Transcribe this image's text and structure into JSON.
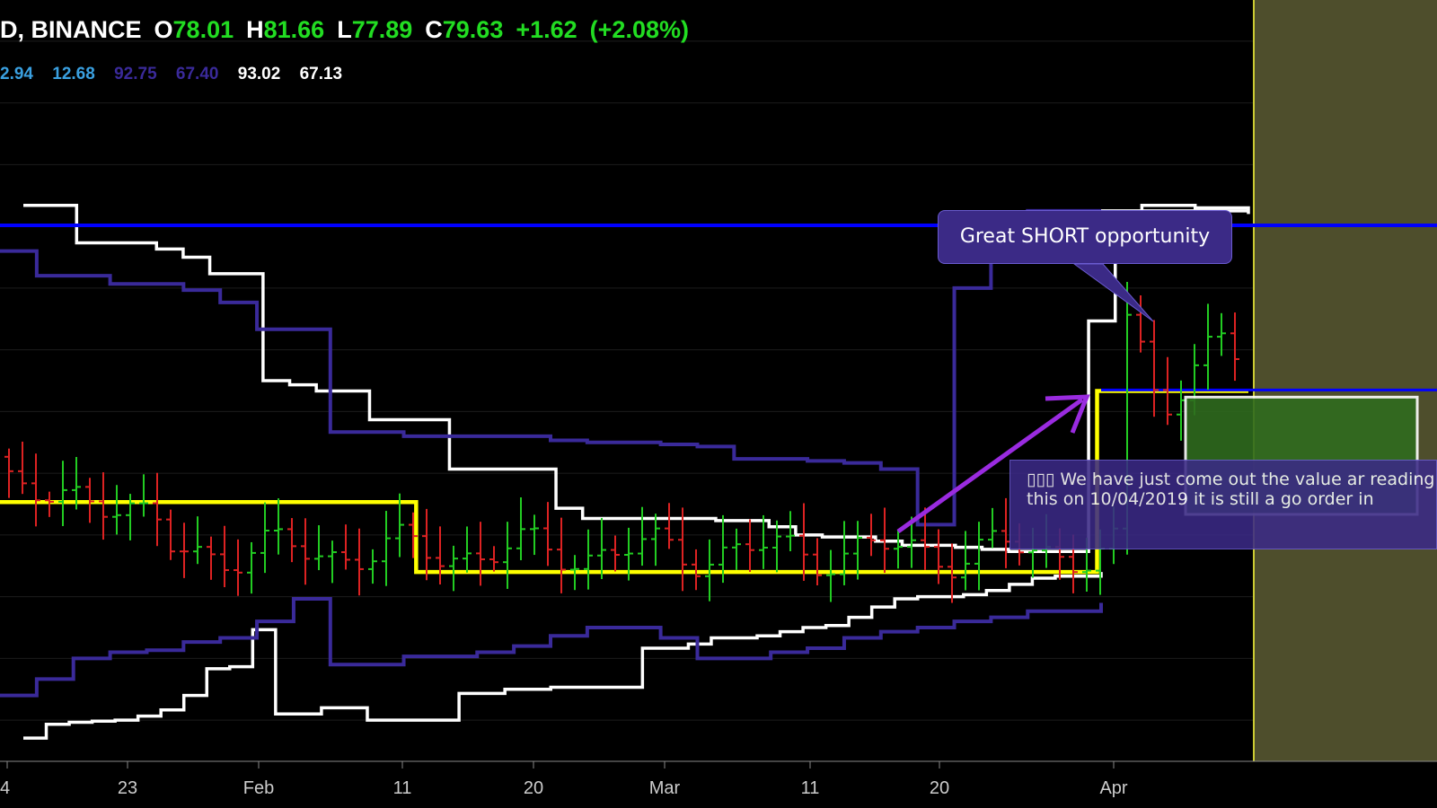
{
  "header": {
    "symbol": "D, BINANCE",
    "open_label": "O",
    "open": "78.01",
    "high_label": "H",
    "high": "81.66",
    "low_label": "L",
    "low": "77.89",
    "close_label": "C",
    "close": "79.63",
    "change": "+1.62",
    "change_pct": "(+2.08%)"
  },
  "indicators": [
    "2.94",
    "12.68",
    "92.75",
    "67.40",
    "93.02",
    "67.13"
  ],
  "colors": {
    "background": "#000000",
    "up": "#22cc22",
    "down": "#dd2222",
    "upper_outer": "#ffffff",
    "inner_band": "#3a2a9a",
    "yellow": "#ffff00",
    "blue": "#0000ff",
    "forecast_zone": "#4e4e2c",
    "arrow": "#9a2be0",
    "value_green": "#2f6b1e",
    "callout_bg": "#3b2a86"
  },
  "annotations": {
    "short_callout": "Great SHORT opportunity",
    "value_callout": "▯▯▯ We have just come out the value ar reading this on 10/04/2019 it is still a go order in"
  },
  "chart_data": {
    "type": "candlestick",
    "x_tick_labels": [
      "4",
      "23",
      "Feb",
      "11",
      "20",
      "Mar",
      "11",
      "20",
      "Apr"
    ],
    "series": [
      {
        "values": [
          93.02,
          93.02,
          91.2,
          91.2,
          91.2,
          90.9,
          90.5,
          89.7,
          89.7,
          84.5,
          84.3,
          84.0,
          84.0,
          82.6,
          82.6,
          82.6,
          80.2,
          80.2,
          80.2,
          80.2,
          78.3,
          77.8,
          77.8,
          77.8,
          77.8,
          77.8,
          77.7,
          77.7,
          77.4,
          77.0,
          76.9,
          76.9,
          76.7,
          76.5,
          76.5,
          76.4,
          76.3,
          76.2,
          76.2,
          76.2,
          87.4,
          92.6,
          93.02,
          93.02,
          92.9,
          92.9,
          92.6
        ]
      },
      {
        "values": [
          67.13,
          67.8,
          67.9,
          67.95,
          68.0,
          68.2,
          68.5,
          69.2,
          70.5,
          70.6,
          72.4,
          68.3,
          68.3,
          68.6,
          68.6,
          68.0,
          68.0,
          68.0,
          68.0,
          69.3,
          69.3,
          69.5,
          69.5,
          69.6,
          69.6,
          69.6,
          69.6,
          71.5,
          71.5,
          71.7,
          72.0,
          72.0,
          72.1,
          72.3,
          72.5,
          72.6,
          73.0,
          73.5,
          73.9,
          74.0,
          74.0,
          74.1,
          74.3,
          74.6,
          74.9,
          75.0,
          75.0,
          75.2
        ]
      },
      {
        "values": [
          90.8,
          89.6,
          89.6,
          89.2,
          89.2,
          88.9,
          88.3,
          87.0,
          87.0,
          82.0,
          82.0,
          81.8,
          81.8,
          81.8,
          81.8,
          81.6,
          81.5,
          81.5,
          81.4,
          81.3,
          80.7,
          80.7,
          80.6,
          80.5,
          80.2,
          77.5,
          89.0,
          92.2,
          92.75,
          92.75,
          92.75
        ]
      },
      {
        "values": [
          69.2,
          70.0,
          71.0,
          71.3,
          71.4,
          71.8,
          72.0,
          72.8,
          73.9,
          70.7,
          70.7,
          71.1,
          71.1,
          71.3,
          71.6,
          72.1,
          72.5,
          72.5,
          72.0,
          71.0,
          71.0,
          71.3,
          71.5,
          72.0,
          72.3,
          72.5,
          72.8,
          73.0,
          73.3,
          73.3,
          73.7
        ]
      },
      {
        "values": [
          78.6,
          78.6,
          78.6,
          78.6,
          78.6,
          78.6,
          78.6,
          78.6,
          78.6,
          78.6,
          78.6,
          75.2,
          75.2,
          75.2,
          75.2,
          75.2,
          75.2,
          75.2,
          75.2,
          75.2,
          75.2,
          75.2,
          75.2,
          75.2,
          75.2,
          75.2,
          75.2,
          75.2,
          75.2,
          84.0,
          84.0,
          84.0,
          84.0,
          84.0
        ]
      },
      {
        "values": [
          92.75,
          92.75
        ]
      }
    ],
    "ylim": [
      66,
      103
    ],
    "grid": true,
    "annotations": [
      "Great SHORT opportunity",
      "We have just come out the value ar reading this on 10/04/2019 it is still a go order in"
    ]
  }
}
